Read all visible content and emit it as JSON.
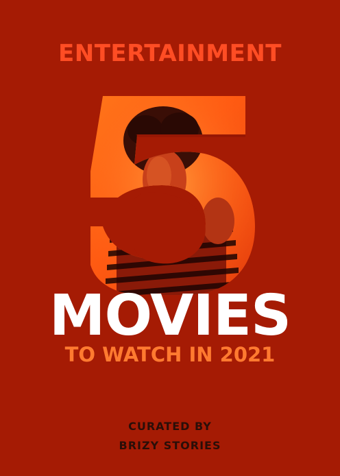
{
  "poster": {
    "category": "ENTERTAINMENT",
    "number": "5",
    "title": "MOVIES",
    "subtitle": "TO WATCH IN 2021",
    "credit_line_1": "CURATED BY",
    "credit_line_2": "BRIZY STORIES"
  },
  "colors": {
    "background": "#a51b04",
    "category_text": "#ff4d24",
    "title_text": "#ffffff",
    "subtitle_text": "#ff7a30",
    "credit_text": "#2a0e08"
  },
  "image": {
    "description_icon": "person-photo-inside-number"
  }
}
